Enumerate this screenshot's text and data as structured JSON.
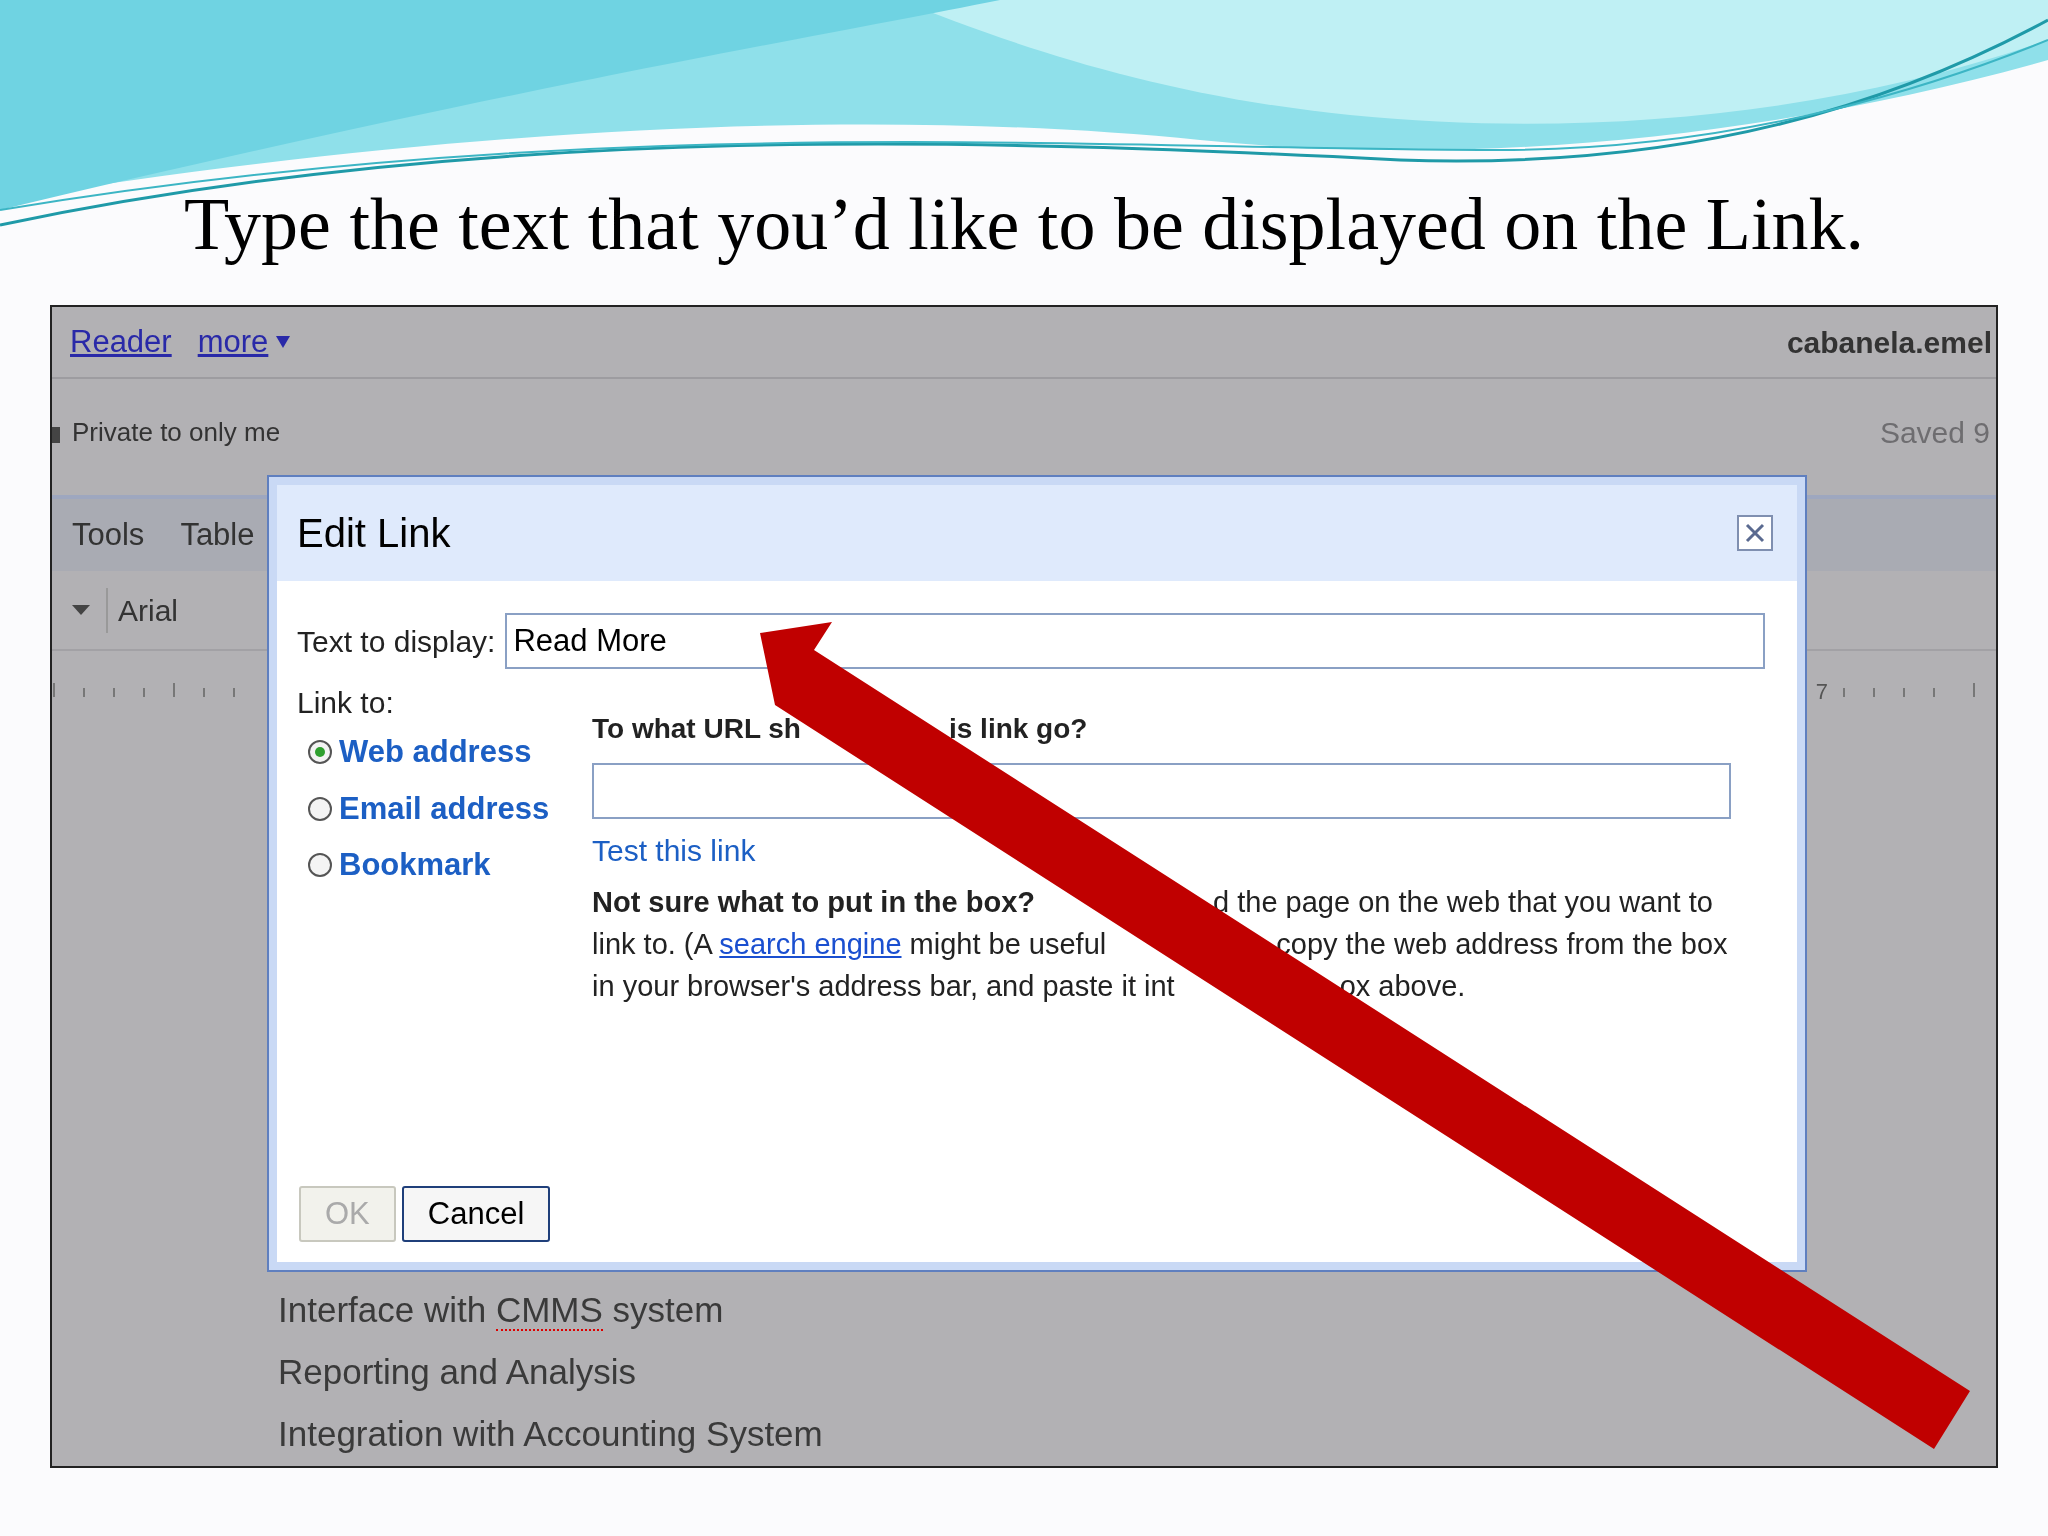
{
  "slide": {
    "title": "Type the text that you’d like to be displayed on the Link."
  },
  "app": {
    "top_links": [
      {
        "label": "Reader",
        "caret": false
      },
      {
        "label": "more",
        "caret": true
      }
    ],
    "account": "cabanela.emel",
    "privacy": "Private to only me",
    "saved_status": "Saved 9",
    "menu": [
      "Tools",
      "Table"
    ],
    "font_select": "Arial",
    "ruler_label": "7",
    "document_lines": [
      {
        "parts": [
          {
            "text": "Interface with ",
            "misspelled": false
          },
          {
            "text": "CMMS",
            "misspelled": true
          },
          {
            "text": " system",
            "misspelled": false
          }
        ]
      },
      {
        "parts": [
          {
            "text": "Reporting and Analysis",
            "misspelled": false
          }
        ]
      },
      {
        "parts": [
          {
            "text": "Integration with Accounting System",
            "misspelled": false
          }
        ]
      }
    ]
  },
  "dialog": {
    "title": "Edit Link",
    "text_label": "Text to display:",
    "text_value": "Read More",
    "link_to_label": "Link to:",
    "link_types": [
      {
        "label": "Web address",
        "selected": true
      },
      {
        "label": "Email address",
        "selected": false
      },
      {
        "label": "Bookmark",
        "selected": false
      }
    ],
    "url_heading": {
      "before": "To what URL sh",
      "after": "is link go?"
    },
    "test_link": "Test this link",
    "help_lines": [
      {
        "before": [
          {
            "kind": "bold",
            "text": "Not sure what to put in the box?"
          }
        ],
        "after": [
          {
            "kind": "text",
            "text": "d the page on the web that you want to"
          }
        ]
      },
      {
        "before": [
          {
            "kind": "text",
            "text": "link to. (A "
          },
          {
            "kind": "link",
            "text": "search engine"
          },
          {
            "kind": "text",
            "text": " might be useful"
          }
        ],
        "after": [
          {
            "kind": "text",
            "text": "copy the web address from the box"
          }
        ]
      },
      {
        "before": [
          {
            "kind": "text",
            "text": "in your browser's address bar, and paste it int"
          }
        ],
        "after": [
          {
            "kind": "text",
            "text": "ox above."
          }
        ]
      }
    ],
    "buttons": [
      {
        "label": "OK",
        "disabled": true
      },
      {
        "label": "Cancel",
        "disabled": false
      }
    ]
  }
}
